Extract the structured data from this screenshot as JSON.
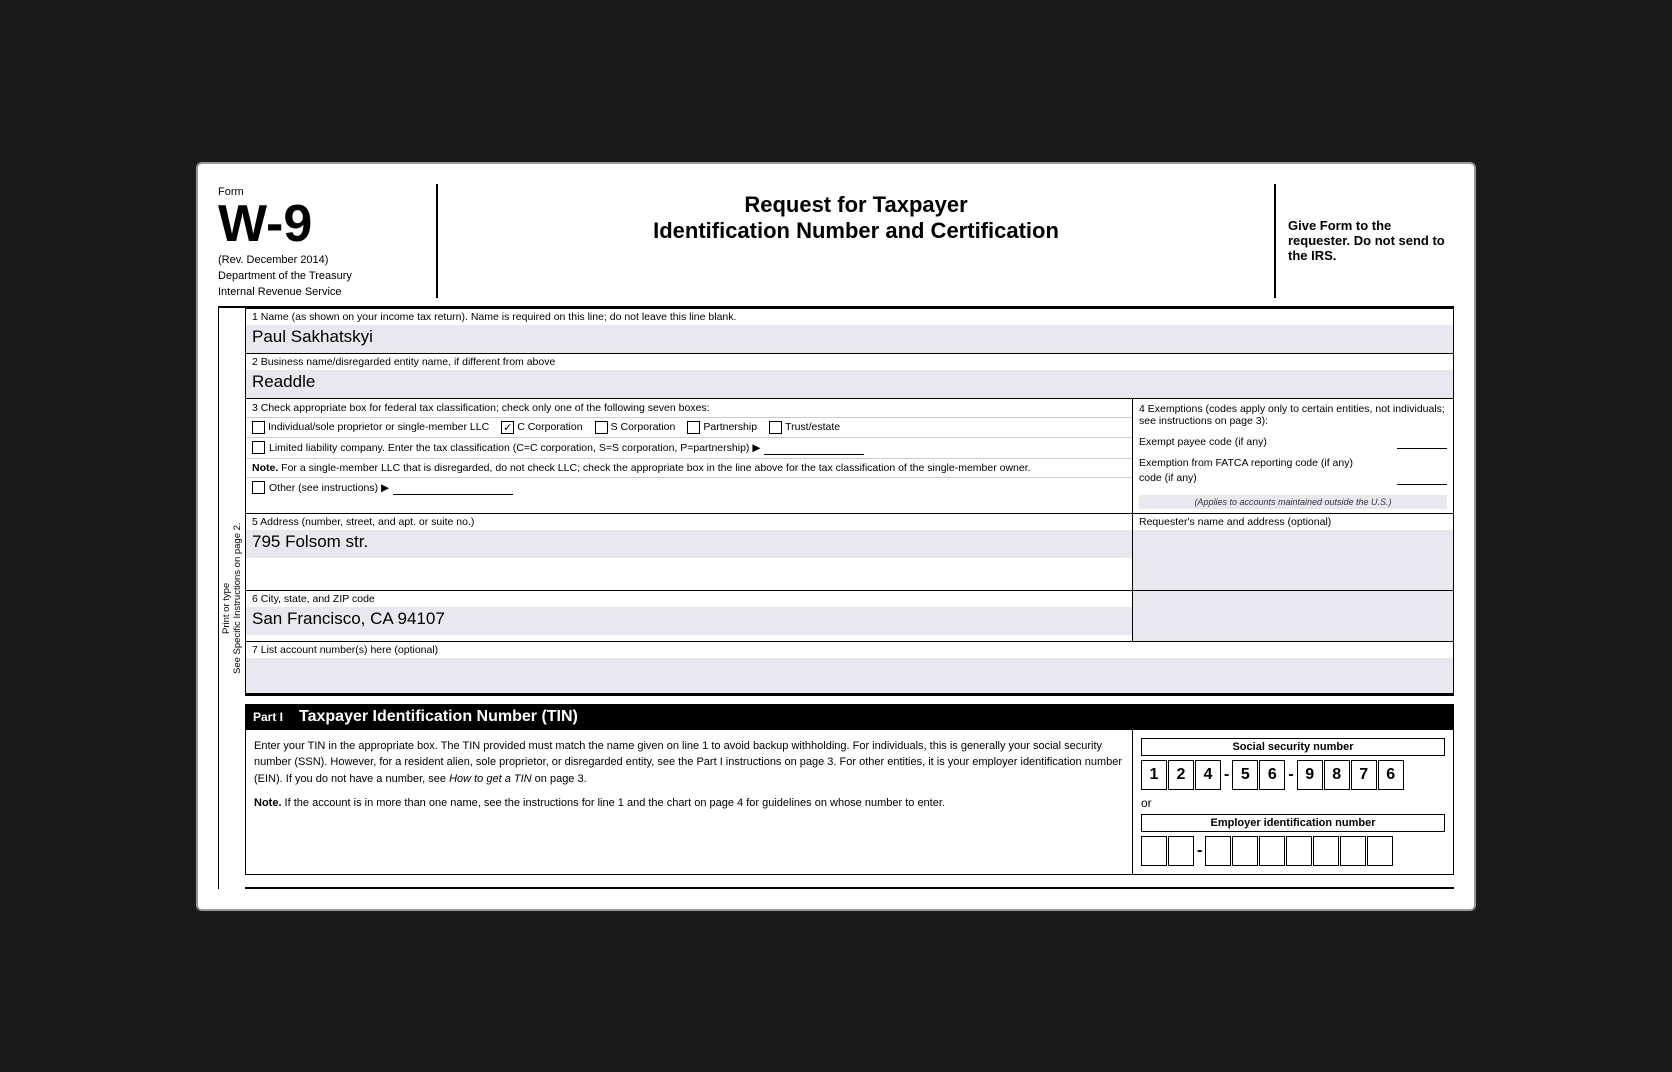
{
  "form": {
    "label": "Form",
    "number": "W-9",
    "rev": "(Rev. December 2014)",
    "dept": "Department of the Treasury",
    "irs": "Internal Revenue Service",
    "title_line1": "Request for Taxpayer",
    "title_line2": "Identification Number and Certification",
    "give_form": "Give Form to the requester. Do not send to the IRS."
  },
  "side_labels": {
    "print_type": "Print or type",
    "see_instructions": "See Specific Instructions on page 2."
  },
  "fields": {
    "field1_label": "1  Name (as shown on your income tax return). Name is required on this line; do not leave this line blank.",
    "field1_value": "Paul Sakhatskyi",
    "field2_label": "2  Business name/disregarded entity name, if different from above",
    "field2_value": "Readdle",
    "field3_label": "3  Check appropriate box for federal tax classification; check only one of the following seven boxes:",
    "checkbox_individual": "Individual/sole proprietor or single-member LLC",
    "checkbox_c_corp": "C Corporation",
    "checkbox_s_corp": "S Corporation",
    "checkbox_partnership": "Partnership",
    "checkbox_trust": "Trust/estate",
    "llc_label": "Limited liability company. Enter the tax classification (C=C corporation, S=S corporation, P=partnership) ▶",
    "note_label": "Note.",
    "note_text": "For a single-member LLC that is disregarded, do not check LLC; check the appropriate box in the line above for the tax classification of the single-member owner.",
    "other_label": "Other (see instructions) ▶",
    "field4_label": "4  Exemptions (codes apply only to certain entities, not individuals; see instructions on page 3):",
    "exempt_payee_label": "Exempt payee code (if any)",
    "fatca_label": "Exemption from FATCA reporting code (if any)",
    "applies_note": "(Applies to accounts maintained outside the U.S.)",
    "field5_label": "5  Address (number, street, and apt. or suite no.)",
    "field5_value": "795 Folsom str.",
    "requester_label": "Requester's name and address (optional)",
    "field6_label": "6  City, state, and ZIP code",
    "field6_value": "San Francisco, CA 94107",
    "field7_label": "7  List account number(s) here (optional)",
    "part1_label": "Part I",
    "part1_title": "Taxpayer Identification Number (TIN)",
    "part1_body": "Enter your TIN in the appropriate box. The TIN provided must match the name given on line 1 to avoid backup withholding. For individuals, this is generally your social security number (SSN). However, for a resident alien, sole proprietor, or disregarded entity, see the Part I instructions on page 3. For other entities, it is your employer identification number (EIN). If you do not have a number, see ",
    "part1_italic": "How to get a TIN",
    "part1_body2": " on page 3.",
    "note2_label": "Note.",
    "note2_text": " If the account is in more than one name, see the instructions for line 1 and the chart on page 4 for guidelines on whose number to enter.",
    "ssn_label": "Social security number",
    "ssn_digits": [
      "1",
      "2",
      "4",
      "",
      "5",
      "6",
      "",
      "9",
      "8",
      "7",
      "6"
    ],
    "or_text": "or",
    "ein_label": "Employer identification number",
    "ein_digits": [
      "",
      "",
      "",
      "",
      "",
      "",
      "",
      "",
      ""
    ]
  }
}
